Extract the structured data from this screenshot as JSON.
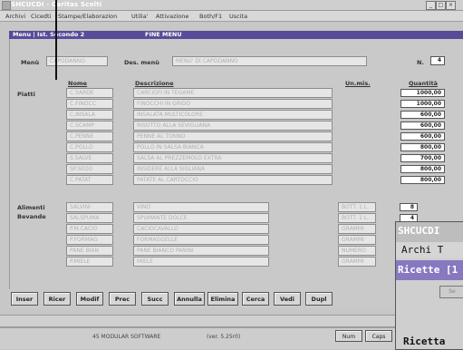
{
  "window": {
    "title": "SHCUCDI - Caritas Scolti",
    "controls": [
      "_",
      "□",
      "×"
    ]
  },
  "menu": {
    "items": [
      "Archivi",
      "Cicedti",
      "Stampe/Elaborazion",
      "Utilia'",
      "Attivazione",
      "Both/F1",
      "Uscita"
    ]
  },
  "form": {
    "header_left": "Menu | Ist. Secondo 2",
    "header_center": "FINE MENU",
    "menu_label": "Menù",
    "menu_value": "CAPODANNO",
    "desc_label": "Des. menù",
    "desc_value": "MENU' DI CAPODANNO",
    "num_label": "N.",
    "num_value": "4",
    "piatti_label": "Piatti",
    "col_nome": "Nome",
    "col_descr": "Descrizione",
    "col_unita": "Un.mis.",
    "col_quant": "Quantità",
    "piatti": [
      {
        "nome": "C.SARDE",
        "descr": "CARCIOFI IN TEGAME",
        "qty": "1000,00"
      },
      {
        "nome": "C.FINOCC",
        "descr": "FINOCCHI IN GRIDO",
        "qty": "1000,00"
      },
      {
        "nome": "C.INSALA",
        "descr": "INSALATA MULTICOLORE",
        "qty": "600,00"
      },
      {
        "nome": "C.SCAMP",
        "descr": "RISOTTO ALLA SEVIGLIANA",
        "qty": "600,00"
      },
      {
        "nome": "C.PENNE",
        "descr": "PENNE AL TONNO",
        "qty": "600,00"
      },
      {
        "nome": "C.POLLO",
        "descr": "POLLO IN SALSA BIANCA",
        "qty": "800,00"
      },
      {
        "nome": "S.SALVE",
        "descr": "SALSA AL PREZZEMOLO EXTRA",
        "qty": "700,00"
      },
      {
        "nome": "SP.SEDO",
        "descr": "INSIDERE ALLA SIGLIANA",
        "qty": "800,00"
      },
      {
        "nome": "C.PATAT",
        "descr": "PATATE AL CARTOCCIO",
        "qty": "800,00"
      }
    ],
    "alimenti_label": "Alimenti",
    "bevande_label": "Bevande",
    "alimenti": [
      {
        "nome": "SALVINI",
        "descr": "VINO",
        "unita": "BOTT. 1 L.",
        "qty": "8"
      },
      {
        "nome": "SALSPUMA",
        "descr": "SPUMANTE DOLCE",
        "unita": "BOTT. 1 L.",
        "qty": "4"
      },
      {
        "nome": "P.M.CACIO",
        "descr": "CACIOCAVALLO",
        "unita": "GRAMMI",
        "qty": ""
      },
      {
        "nome": "P.FORMAG",
        "descr": "FORMAGGELLE",
        "unita": "GRAMMI",
        "qty": ""
      },
      {
        "nome": "PANE BIAN",
        "descr": "PANE BIANCO PANINI",
        "unita": "NUMERO",
        "qty": ""
      },
      {
        "nome": "P.MIELE",
        "descr": "MIELE",
        "unita": "GRAMMI",
        "qty": ""
      }
    ]
  },
  "buttons": [
    "Inser",
    "Ricer",
    "Modif",
    "Prec",
    "Succ",
    "Annulla",
    "Elimina",
    "Cerca",
    "Vedi",
    "Dupl"
  ],
  "status": {
    "company": "45 MODULAR SOFTWARE",
    "version": "(ver. 5.25r0)",
    "btn_a": "Num",
    "btn_b": "Caps"
  },
  "overlay": {
    "title": "SHCUCDI",
    "menu_text": "Archi  T",
    "header": "Ricette [1",
    "button": "Se",
    "bottom_text": "Ricetta"
  }
}
